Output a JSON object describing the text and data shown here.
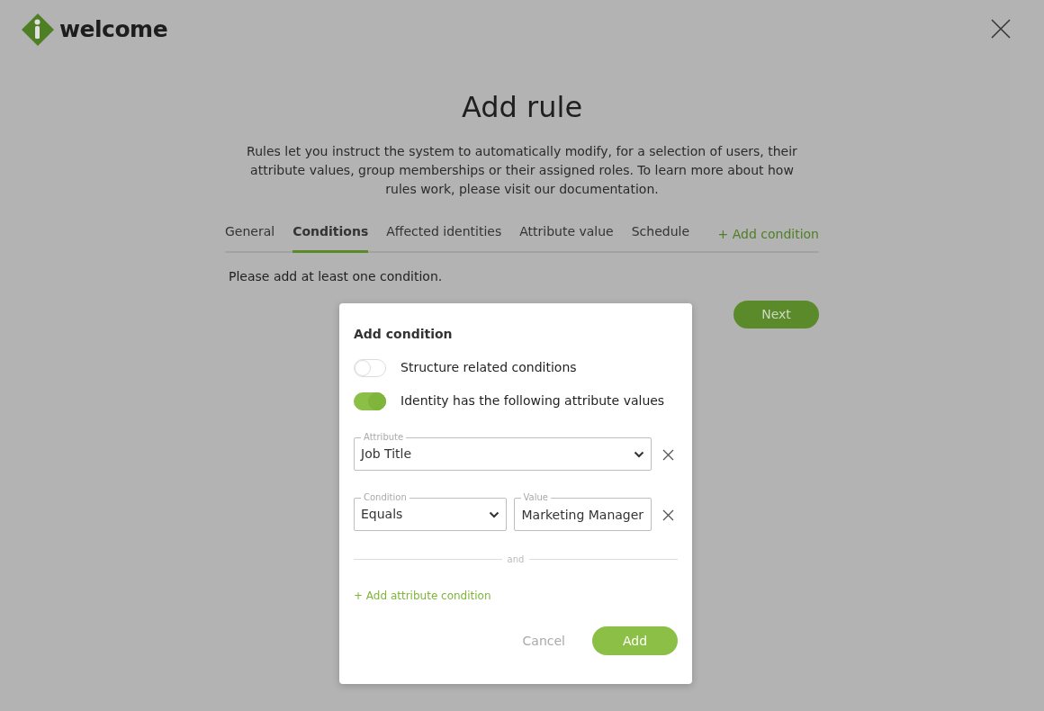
{
  "logo": {
    "text": "welcome"
  },
  "title": "Add rule",
  "description": "Rules let you instruct the system to automatically modify, for a selection of users, their attribute values, group memberships or their assigned roles. To learn more about how rules work, please visit our documentation.",
  "tabs": [
    {
      "label": "General",
      "selected": false
    },
    {
      "label": "Conditions",
      "selected": true
    },
    {
      "label": "Affected identities",
      "selected": false
    },
    {
      "label": "Attribute value",
      "selected": false
    },
    {
      "label": "Schedule",
      "selected": false
    }
  ],
  "add_condition_link": "+ Add condition",
  "empty_message": "Please add at least one condition.",
  "next_button": "Next",
  "dialog": {
    "title": "Add condition",
    "toggles": [
      {
        "label": "Structure related conditions",
        "on": false
      },
      {
        "label": "Identity has the following attribute values",
        "on": true
      }
    ],
    "rows": [
      [
        {
          "kind": "select",
          "label": "Attribute",
          "value": "Job Title"
        }
      ],
      [
        {
          "kind": "select",
          "label": "Condition",
          "value": "Equals"
        },
        {
          "kind": "input",
          "label": "Value",
          "value": "Marketing Manager"
        }
      ]
    ],
    "separator": "and",
    "add_link": "+ Add attribute condition",
    "cancel_button": "Cancel",
    "add_button": "Add"
  }
}
